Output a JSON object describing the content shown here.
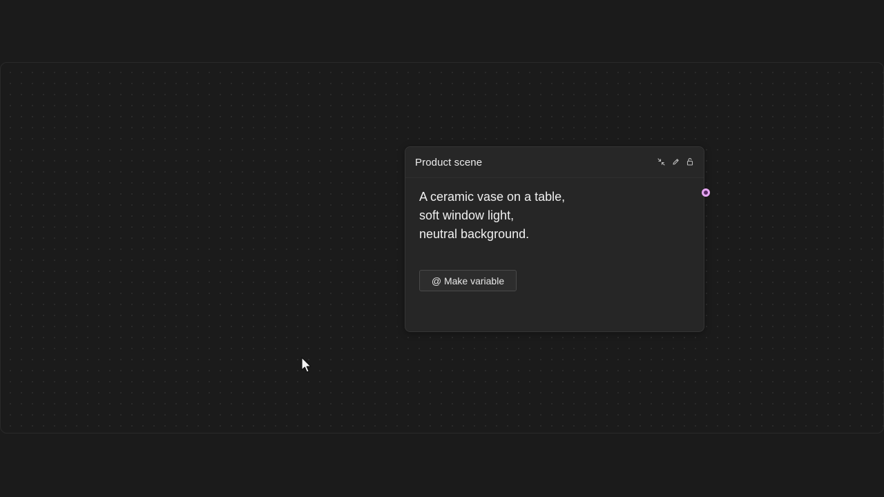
{
  "node": {
    "title": "Product scene",
    "icons": [
      "collapse-icon",
      "pencil-icon",
      "lock-icon"
    ],
    "prompt_lines": [
      "A ceramic vase on a table,",
      "soft window light,",
      "neutral background."
    ],
    "make_variable_label": "@ Make variable"
  },
  "colors": {
    "background": "#1b1b1b",
    "node_background": "#262626",
    "port_accent": "#e6a6f2"
  }
}
